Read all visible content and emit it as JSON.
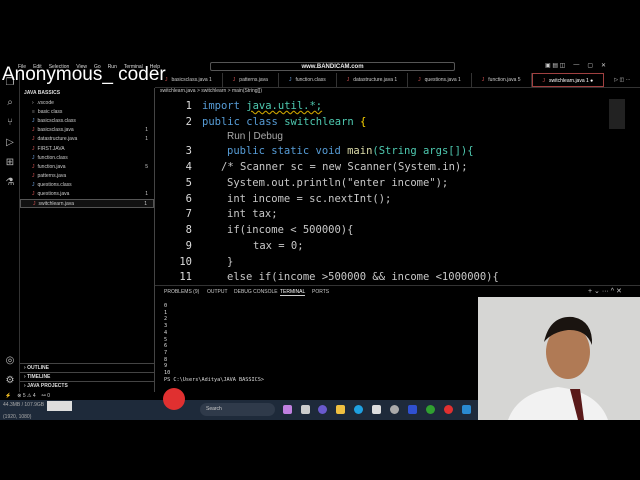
{
  "watermark": "Anonymous_ coder",
  "recorder": "www.BANDICAM.com",
  "menu": [
    "File",
    "Edit",
    "Selection",
    "View",
    "Go",
    "Run",
    "Terminal",
    "Help"
  ],
  "explorer": {
    "title": "JAVA BASSICS",
    "items": [
      {
        "label": ".vscode",
        "icon": "folder"
      },
      {
        "label": "basic class",
        "icon": "class"
      },
      {
        "label": "basicsclass.class",
        "icon": "java"
      },
      {
        "label": "basicsclass.java",
        "icon": "java",
        "badge": "1"
      },
      {
        "label": "datastructure.java",
        "icon": "java",
        "badge": "1"
      },
      {
        "label": "FIRST.JAVA",
        "icon": "java"
      },
      {
        "label": "function.class",
        "icon": "java"
      },
      {
        "label": "function.java",
        "icon": "java",
        "badge": "5"
      },
      {
        "label": "patterns.java",
        "icon": "java"
      },
      {
        "label": "questions.class",
        "icon": "java"
      },
      {
        "label": "questions.java",
        "icon": "java",
        "badge": "1"
      },
      {
        "label": "switchlearn.java",
        "icon": "java",
        "badge": "1"
      }
    ],
    "sections": [
      "OUTLINE",
      "TIMELINE",
      "JAVA PROJECTS"
    ]
  },
  "tabs": [
    "basicsclass.java 1",
    "patterns.java",
    "function.class",
    "datastructure.java 1",
    "questions.java 1",
    "function.java 5",
    "switchlearn.java 1"
  ],
  "breadcrumb": "switchlearn.java > switchlearn > main(String[])",
  "code_lens": "Run | Debug",
  "line_numbers": [
    "1",
    "2",
    "3",
    "4",
    "5",
    "6",
    "7",
    "8",
    "9",
    "10",
    "11"
  ],
  "code": {
    "l1a": "import ",
    "l1b": "java.util.*;",
    "l2a": "public class ",
    "l2b": "switchlearn ",
    "l2c": "{",
    "l3a": "public static void ",
    "l3b": "main",
    "l3c": "(String args[]){",
    "l4": "/* Scanner sc = new Scanner(System.in);",
    "l5": "System.out.println(\"enter income\");",
    "l6": "int income = sc.nextInt();",
    "l7": "int tax;",
    "l8": "if(income < 500000){",
    "l9": "tax = 0;",
    "l10": "}",
    "l11": "else if(income >500000 && income <1000000){"
  },
  "panel": {
    "tabs": [
      "PROBLEMS",
      "OUTPUT",
      "DEBUG CONSOLE",
      "TERMINAL",
      "PORTS"
    ],
    "problems_count": "9",
    "terminal": [
      "0",
      "1",
      "2",
      "3",
      "4",
      "5",
      "6",
      "7",
      "8",
      "9",
      "10",
      "PS C:\\Users\\Aditya\\JAVA BASSICS>"
    ]
  },
  "status": {
    "errors": "5",
    "warnings": "4",
    "ports": "0"
  },
  "taskbar": {
    "search": "Search",
    "memory": "44.3MB / 107.9GB",
    "resolution": "(1920, 1080)"
  }
}
